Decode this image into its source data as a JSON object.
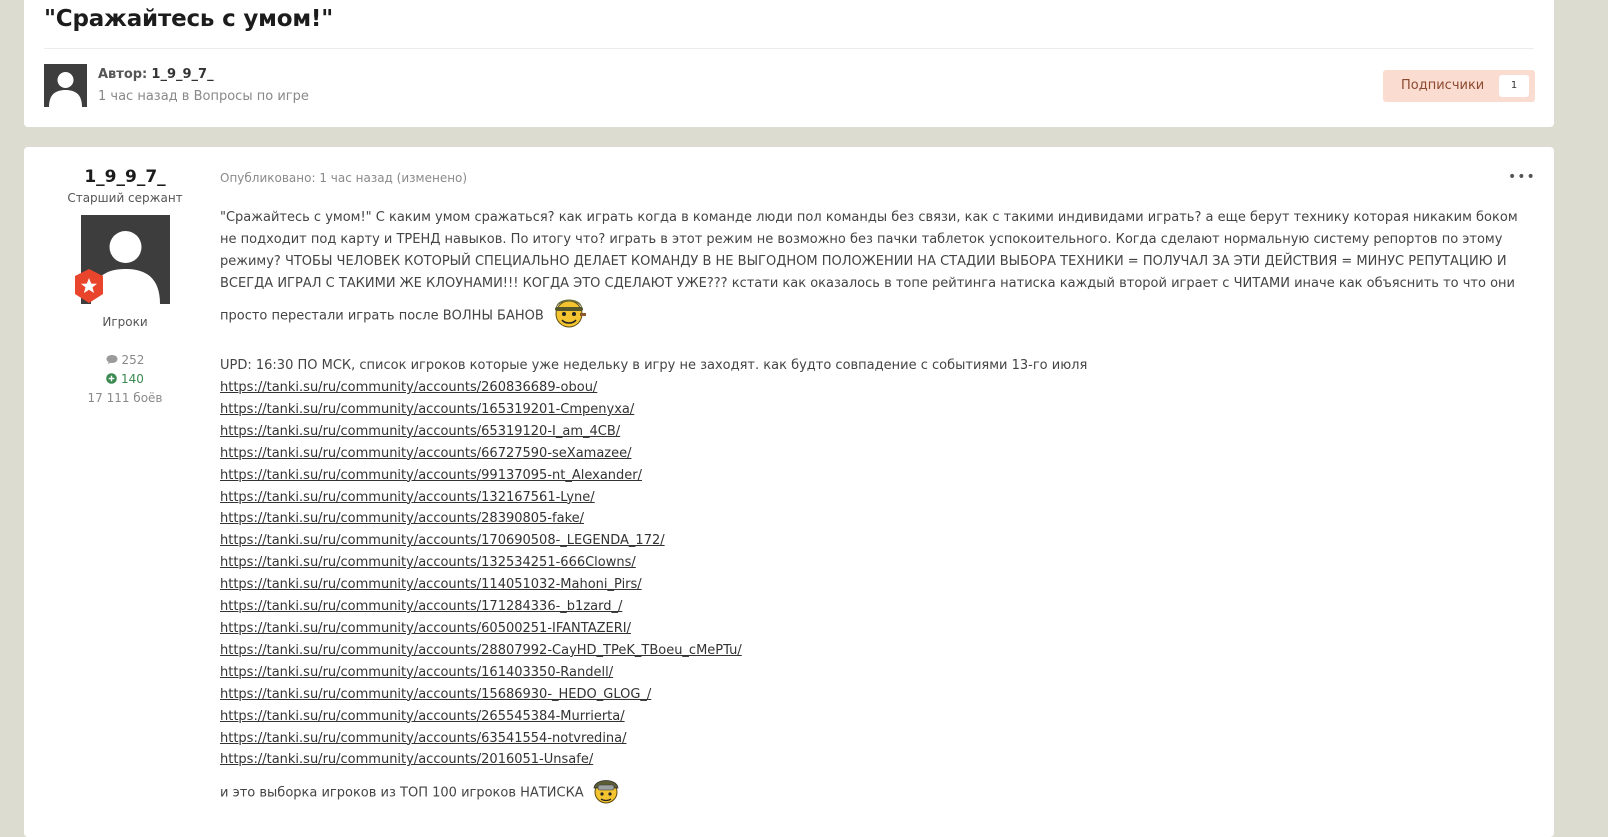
{
  "topic": {
    "title": "\"Сражайтесь с умом!\"",
    "author_label": "Автор:",
    "author_name": "1_9_9_7_",
    "time": "1 час назад в",
    "category": "Вопросы по игре",
    "follow_label": "Подписчики",
    "follow_count": "1"
  },
  "post_author": {
    "name": "1_9_9_7_",
    "rank": "Старший сержант",
    "group": "Игроки",
    "posts": "252",
    "reputation": "140",
    "battles": "17 111 боёв"
  },
  "post": {
    "published": "Опубликовано: 1 час назад (изменено)",
    "menu": "•••",
    "paragraph": "\"Сражайтесь с умом!\" С каким умом сражаться? как играть когда в команде люди пол команды без связи, как с такими индивидами играть? а еще берут технику которая никаким боком не подходит под карту и ТРЕНД навыков. По итогу что? играть в этот режим не возможно без пачки таблеток успокоительного. Когда сделают нормальную систему репортов по этому режиму? ЧТОБЫ ЧЕЛОВЕК КОТОРЫЙ СПЕЦИАЛЬНО ДЕЛАЕТ КОМАНДУ В НЕ ВЫГОДНОМ ПОЛОЖЕНИИ НА СТАДИИ ВЫБОРА ТЕХНИКИ = ПОЛУЧАЛ ЗА ЭТИ ДЕЙСТВИЯ = МИНУС РЕПУТАЦИЮ И ВСЕГДА ИГРАЛ С ТАКИМИ ЖЕ КЛОУНАМИ!!! КОГДА ЭТО СДЕЛАЮТ УЖЕ??? кстати как оказалось в топе рейтинга натиска каждый второй играет с ЧИТАМИ иначе как объяснить то что они просто перестали играть после ВОЛНЫ БАНОВ",
    "upd": "UPD: 16:30 ПО МСК, список игроков которые уже недельку в игру не заходят. как будто совпадение с событиями 13-го июля",
    "links": [
      "https://tanki.su/ru/community/accounts/260836689-obou/",
      "https://tanki.su/ru/community/accounts/165319201-Cmpenyxa/",
      "https://tanki.su/ru/community/accounts/65319120-I_am_4CB/",
      "https://tanki.su/ru/community/accounts/66727590-seXamazee/",
      "https://tanki.su/ru/community/accounts/99137095-nt_Alexander/",
      "https://tanki.su/ru/community/accounts/132167561-Lyne/",
      "https://tanki.su/ru/community/accounts/28390805-fake/",
      "https://tanki.su/ru/community/accounts/170690508-_LEGENDA_172/",
      "https://tanki.su/ru/community/accounts/132534251-666Clowns/",
      "https://tanki.su/ru/community/accounts/114051032-Mahoni_Pirs/",
      "https://tanki.su/ru/community/accounts/171284336-_b1zard_/",
      "https://tanki.su/ru/community/accounts/60500251-IFANTAZERI/",
      "https://tanki.su/ru/community/accounts/28807992-CayHD_TPeK_TBoeu_cMePTu/",
      "https://tanki.su/ru/community/accounts/161403350-Randell/",
      "https://tanki.su/ru/community/accounts/15686930-_HEDO_GLOG_/",
      "https://tanki.su/ru/community/accounts/265545384-Murrierta/",
      "https://tanki.su/ru/community/accounts/63541554-notvredina/",
      "https://tanki.su/ru/community/accounts/2016051-Unsafe/"
    ],
    "final": "и это выборка игроков из ТОП 100 игроков НАТИСКА"
  },
  "icons": {
    "comment": "comment-icon",
    "reputation": "plus-circle-icon",
    "badge": "rank-star-badge-icon",
    "emoji1": "smiley-soldier-emoji-icon",
    "emoji2": "smiley-helmet-emoji-icon"
  },
  "colors": {
    "page_bg": "#dcdcd0",
    "follow_bg": "#fbdcd0",
    "follow_text": "#8a4a2f",
    "reputation": "#3b8a52",
    "badge": "#e8452c"
  }
}
